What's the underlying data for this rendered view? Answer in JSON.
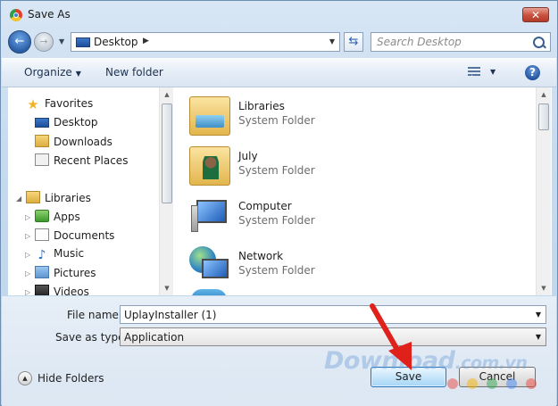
{
  "window": {
    "title": "Save As",
    "close_glyph": "✕"
  },
  "nav": {
    "back_glyph": "←",
    "forward_glyph": "→"
  },
  "address": {
    "location": "Desktop",
    "separator": "▶"
  },
  "search": {
    "placeholder": "Search Desktop"
  },
  "toolbar": {
    "organize": "Organize",
    "new_folder": "New folder",
    "help_glyph": "?"
  },
  "nav_pane": {
    "favorites": {
      "label": "Favorites",
      "items": [
        {
          "label": "Desktop",
          "icon": "desktop-icon"
        },
        {
          "label": "Downloads",
          "icon": "downloads-folder-icon"
        },
        {
          "label": "Recent Places",
          "icon": "recent-places-icon"
        }
      ]
    },
    "libraries": {
      "label": "Libraries",
      "items": [
        {
          "label": "Apps",
          "icon": "apps-library-icon"
        },
        {
          "label": "Documents",
          "icon": "documents-library-icon"
        },
        {
          "label": "Music",
          "icon": "music-library-icon"
        },
        {
          "label": "Pictures",
          "icon": "pictures-library-icon"
        },
        {
          "label": "Videos",
          "icon": "videos-library-icon"
        }
      ]
    }
  },
  "files": [
    {
      "name": "Libraries",
      "type": "System Folder",
      "icon": "libraries-folder-icon"
    },
    {
      "name": "July",
      "type": "System Folder",
      "icon": "user-folder-icon"
    },
    {
      "name": "Computer",
      "type": "System Folder",
      "icon": "computer-icon"
    },
    {
      "name": "Network",
      "type": "System Folder",
      "icon": "network-icon"
    }
  ],
  "form": {
    "file_name_label": "File name:",
    "file_name_value": "UplayInstaller (1)",
    "save_type_label": "Save as type:",
    "save_type_value": "Application"
  },
  "footer": {
    "hide_folders": "Hide Folders",
    "save": "Save",
    "cancel": "Cancel"
  },
  "watermark": {
    "brand": "Download",
    "suffix": ".com.vn"
  },
  "colors": {
    "annotation_arrow": "#e0201b",
    "watermark_dots": [
      "#e8453c",
      "#f5b400",
      "#34a853",
      "#4285f4",
      "#e8453c"
    ]
  }
}
